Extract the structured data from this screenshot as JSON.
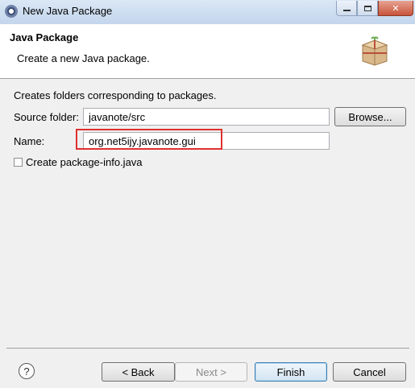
{
  "window": {
    "title": "New Java Package",
    "icon": "eclipse-icon"
  },
  "banner": {
    "title": "Java Package",
    "description": "Create a new Java package.",
    "icon": "package-icon"
  },
  "content": {
    "description": "Creates folders corresponding to packages.",
    "source_folder": {
      "label": "Source folder:",
      "value": "javanote/src"
    },
    "name": {
      "label": "Name:",
      "value": "org.net5ijy.javanote.gui"
    },
    "browse_label": "Browse...",
    "create_package_info": {
      "label": "Create package-info.java",
      "checked": false
    }
  },
  "footer": {
    "help_glyph": "?",
    "back_label": "< Back",
    "next_label": "Next >",
    "finish_label": "Finish",
    "cancel_label": "Cancel"
  },
  "colors": {
    "highlight": "#e03030",
    "titlebar": "#c9dcf0"
  }
}
